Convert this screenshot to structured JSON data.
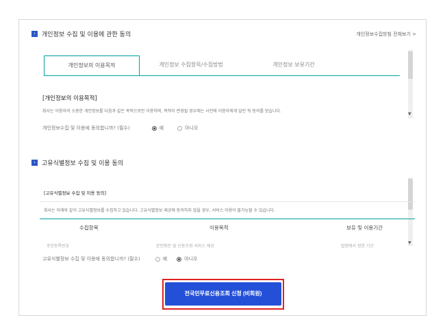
{
  "section1": {
    "title": "개인정보 수집 및 이용에 관한 동의",
    "view_all": "개인정보수집방침 전체보기 >",
    "tabs": [
      {
        "label": "개인정보의 이용목적",
        "active": true
      },
      {
        "label": "개인정보 수집항목/수집방법",
        "active": false
      },
      {
        "label": "개인정보 보유기간",
        "active": false
      }
    ],
    "purpose_title": "[개인정보의 이용목적]",
    "purpose_text": "회사는 이용자의 소중한 개인정보를 다음과 같은 목적으로만 이용하며, 목적이 변경될 경우에는 사전에 이용자에게 알린 뒤 동의를 받습니다.",
    "consent_question": "개인정보수집 및 이용에 동의합니까? (필수)",
    "consent_yes": "예",
    "consent_no": "아니오",
    "consent_selected": "yes"
  },
  "section2": {
    "title": "고유식별정보 수집 및 이용 동의",
    "box_title": "[고유식별정보 수집 및 이용 동의]",
    "box_text": "회사는 아래와 같이 고유식별정보를 수집하고 있습니다. 고유식별정보 제공에 동의하지 않을 경우, 서비스 이용이 불가능할 수 있습니다.",
    "columns": [
      "수집항목",
      "이용목적",
      "보유 및 이용기간"
    ],
    "row": [
      "주민등록번호",
      "본인확인 및 신용조회 서비스 제공",
      "법령에서 정한 기간"
    ],
    "consent_question": "고유식별정보 수집 및 이용에 동의합니까? (필수)",
    "consent_yes": "예",
    "consent_no": "아니오",
    "consent_selected": "no"
  },
  "cta": {
    "label": "전국민무료신용조회 신청 (비회원)"
  },
  "colors": {
    "accent_teal": "#00a0a0",
    "button_blue": "#2450d8",
    "highlight_red": "#e02020",
    "section_icon_blue": "#2b56c6"
  }
}
